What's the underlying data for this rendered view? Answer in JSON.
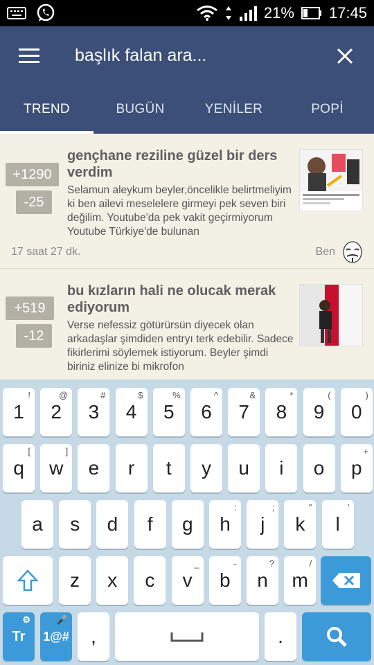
{
  "status_bar": {
    "battery": "21%",
    "time": "17:45"
  },
  "header": {
    "search_text": "başlık falan ara..."
  },
  "tabs": [
    {
      "label": "TREND",
      "active": true
    },
    {
      "label": "BUGÜN",
      "active": false
    },
    {
      "label": "YENİLER",
      "active": false
    },
    {
      "label": "POPİ",
      "active": false
    }
  ],
  "entries": [
    {
      "upvotes": "+1290",
      "downvotes": "-25",
      "title": "gençhane reziline güzel bir ders verdim",
      "body": "Selamun aleykum beyler,öncelikle belirtmeliyim ki ben ailevi meselelere girmeyi pek seven biri değilim. Youtube'da pek vakit geçirmiyorum Youtube Türkiye'de bulunan",
      "time": "17 saat 27 dk.",
      "author": "Ben"
    },
    {
      "upvotes": "+519",
      "downvotes": "-12",
      "title": "bu kızların hali ne olucak merak ediyorum",
      "body": "Verse nefessiz götürürsün diyecek olan arkadaşlar şimdiden entryı terk edebilir. Sadece fikirlerimi söylemek istiyorum. Beyler şimdi biriniz elinize bi mikrofon"
    }
  ],
  "keyboard": {
    "row1": [
      {
        "main": "1",
        "sub": "!"
      },
      {
        "main": "2",
        "sub": "@"
      },
      {
        "main": "3",
        "sub": "#"
      },
      {
        "main": "4",
        "sub": "$"
      },
      {
        "main": "5",
        "sub": "%"
      },
      {
        "main": "6",
        "sub": "^"
      },
      {
        "main": "7",
        "sub": "&"
      },
      {
        "main": "8",
        "sub": "*"
      },
      {
        "main": "9",
        "sub": "("
      },
      {
        "main": "0",
        "sub": ")"
      }
    ],
    "row2": [
      {
        "main": "q",
        "sub": "["
      },
      {
        "main": "w",
        "sub": "]"
      },
      {
        "main": "e",
        "sub": ""
      },
      {
        "main": "r",
        "sub": ""
      },
      {
        "main": "t",
        "sub": ""
      },
      {
        "main": "y",
        "sub": ""
      },
      {
        "main": "u",
        "sub": ""
      },
      {
        "main": "i",
        "sub": ""
      },
      {
        "main": "o",
        "sub": ""
      },
      {
        "main": "p",
        "sub": "+"
      }
    ],
    "row3": [
      {
        "main": "a",
        "sub": ""
      },
      {
        "main": "s",
        "sub": ""
      },
      {
        "main": "d",
        "sub": ""
      },
      {
        "main": "f",
        "sub": ""
      },
      {
        "main": "g",
        "sub": ""
      },
      {
        "main": "h",
        "sub": ":"
      },
      {
        "main": "j",
        "sub": ";"
      },
      {
        "main": "k",
        "sub": "\""
      },
      {
        "main": "l",
        "sub": "'"
      }
    ],
    "row4": [
      {
        "main": "z",
        "sub": ""
      },
      {
        "main": "x",
        "sub": ""
      },
      {
        "main": "c",
        "sub": ""
      },
      {
        "main": "v",
        "sub": "_"
      },
      {
        "main": "b",
        "sub": "-"
      },
      {
        "main": "n",
        "sub": "?"
      },
      {
        "main": "m",
        "sub": "/"
      }
    ],
    "lang_key": "Tr",
    "symbols_key": "1@#",
    "comma_key": ",",
    "period_key": "."
  },
  "colors": {
    "header_bg": "#3b4f78",
    "feed_bg": "#f3f0e6",
    "keyboard_bg": "#c5d9e6",
    "key_accent": "#3d9ad8"
  }
}
